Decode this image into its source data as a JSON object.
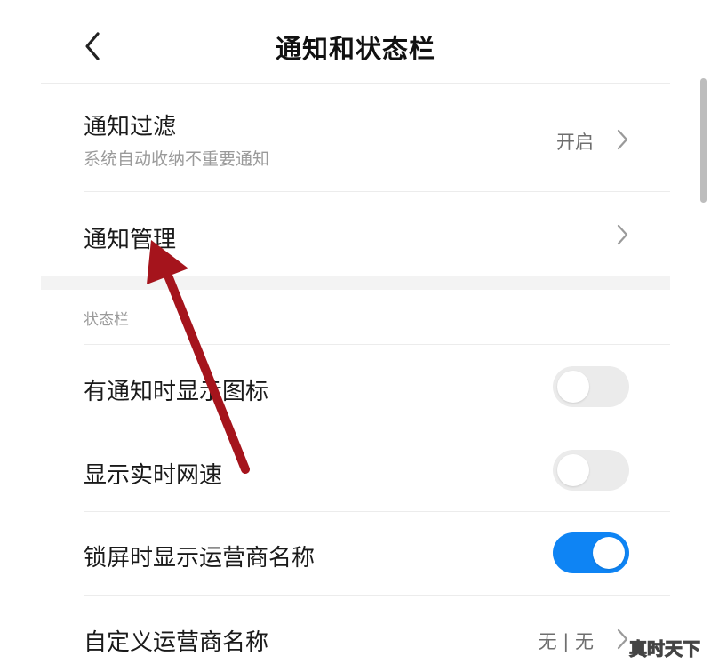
{
  "header": {
    "title": "通知和状态栏",
    "back_icon": "back-arrow-icon"
  },
  "rows": {
    "notification_filter": {
      "title": "通知过滤",
      "subtitle": "系统自动收纳不重要通知",
      "value": "开启"
    },
    "notification_management": {
      "title": "通知管理"
    }
  },
  "status_bar": {
    "section_label": "状态栏",
    "items": [
      {
        "label": "有通知时显示图标",
        "toggle": false
      },
      {
        "label": "显示实时网速",
        "toggle": false
      },
      {
        "label": "锁屏时显示运营商名称",
        "toggle": true
      }
    ],
    "carrier_name": {
      "label": "自定义运营商名称",
      "value": "无 | 无"
    }
  },
  "colors": {
    "toggle_on": "#0e84f4",
    "toggle_off": "#ebebeb",
    "annotation_arrow": "#a5141c"
  },
  "watermark": "真时天下"
}
